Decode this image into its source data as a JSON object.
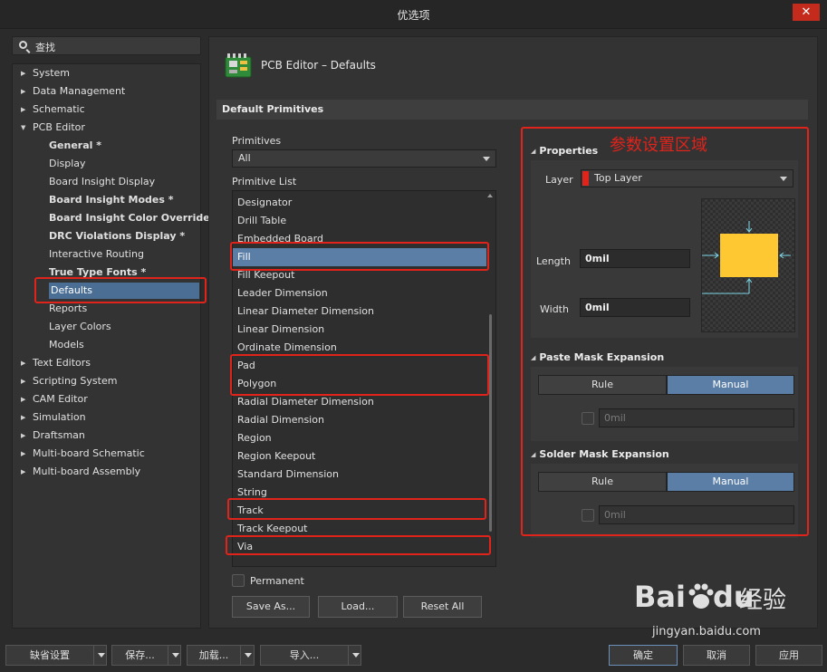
{
  "window": {
    "title": "优选项",
    "close_icon": "close-icon"
  },
  "search": {
    "placeholder": "查找"
  },
  "tree": [
    {
      "label": "System",
      "level": 0,
      "arrow": "▶"
    },
    {
      "label": "Data Management",
      "level": 0,
      "arrow": "▶"
    },
    {
      "label": "Schematic",
      "level": 0,
      "arrow": "▶"
    },
    {
      "label": "PCB Editor",
      "level": 0,
      "arrow": "▼"
    },
    {
      "label": "General *",
      "level": 1,
      "bold": true
    },
    {
      "label": "Display",
      "level": 1
    },
    {
      "label": "Board Insight Display",
      "level": 1
    },
    {
      "label": "Board Insight Modes *",
      "level": 1,
      "bold": true
    },
    {
      "label": "Board Insight Color Overrides *",
      "level": 1,
      "bold": true
    },
    {
      "label": "DRC Violations Display *",
      "level": 1,
      "bold": true
    },
    {
      "label": "Interactive Routing",
      "level": 1
    },
    {
      "label": "True Type Fonts *",
      "level": 1,
      "bold": true
    },
    {
      "label": "Defaults",
      "level": 1,
      "selected": true
    },
    {
      "label": "Reports",
      "level": 1
    },
    {
      "label": "Layer Colors",
      "level": 1
    },
    {
      "label": "Models",
      "level": 1
    },
    {
      "label": "Text Editors",
      "level": 0,
      "arrow": "▶"
    },
    {
      "label": "Scripting System",
      "level": 0,
      "arrow": "▶"
    },
    {
      "label": "CAM Editor",
      "level": 0,
      "arrow": "▶"
    },
    {
      "label": "Simulation",
      "level": 0,
      "arrow": "▶"
    },
    {
      "label": "Draftsman",
      "level": 0,
      "arrow": "▶"
    },
    {
      "label": "Multi-board Schematic",
      "level": 0,
      "arrow": "▶"
    },
    {
      "label": "Multi-board Assembly",
      "level": 0,
      "arrow": "▶"
    }
  ],
  "page": {
    "title": "PCB Editor – Defaults",
    "section": "Default Primitives"
  },
  "primitives": {
    "label": "Primitives",
    "selected": "All",
    "list_label": "Primitive List",
    "items": [
      "Designator",
      "Drill Table",
      "Embedded Board",
      "Fill",
      "Fill Keepout",
      "Leader Dimension",
      "Linear Diameter Dimension",
      "Linear Dimension",
      "Ordinate Dimension",
      "Pad",
      "Polygon",
      "Radial Diameter Dimension",
      "Radial Dimension",
      "Region",
      "Region Keepout",
      "Standard Dimension",
      "String",
      "Track",
      "Track Keepout",
      "Via"
    ],
    "selected_item": "Fill",
    "permanent_label": "Permanent",
    "permanent_checked": false,
    "buttons": {
      "save_as": "Save As...",
      "load": "Load...",
      "reset_all": "Reset All"
    }
  },
  "properties": {
    "title": "Properties",
    "layer_label": "Layer",
    "layer_value": "Top Layer",
    "layer_color": "#e0231b",
    "length_label": "Length",
    "length_value": "0mil",
    "width_label": "Width",
    "width_value": "0mil",
    "fill_color": "#fec833"
  },
  "paste_mask": {
    "title": "Paste Mask Expansion",
    "rule": "Rule",
    "manual": "Manual",
    "value": "0mil"
  },
  "solder_mask": {
    "title": "Solder Mask Expansion",
    "rule": "Rule",
    "manual": "Manual",
    "value": "0mil"
  },
  "annotation": {
    "text": "参数设置区域",
    "color": "#e0231b"
  },
  "footer": {
    "defaults": "缺省设置",
    "save": "保存...",
    "load": "加载...",
    "import": "导入...",
    "ok": "确定",
    "cancel": "取消",
    "apply": "应用"
  },
  "watermark": {
    "brand": "Bai",
    "brand2": "du",
    "suffix": "经验",
    "url": "jingyan.baidu.com"
  }
}
